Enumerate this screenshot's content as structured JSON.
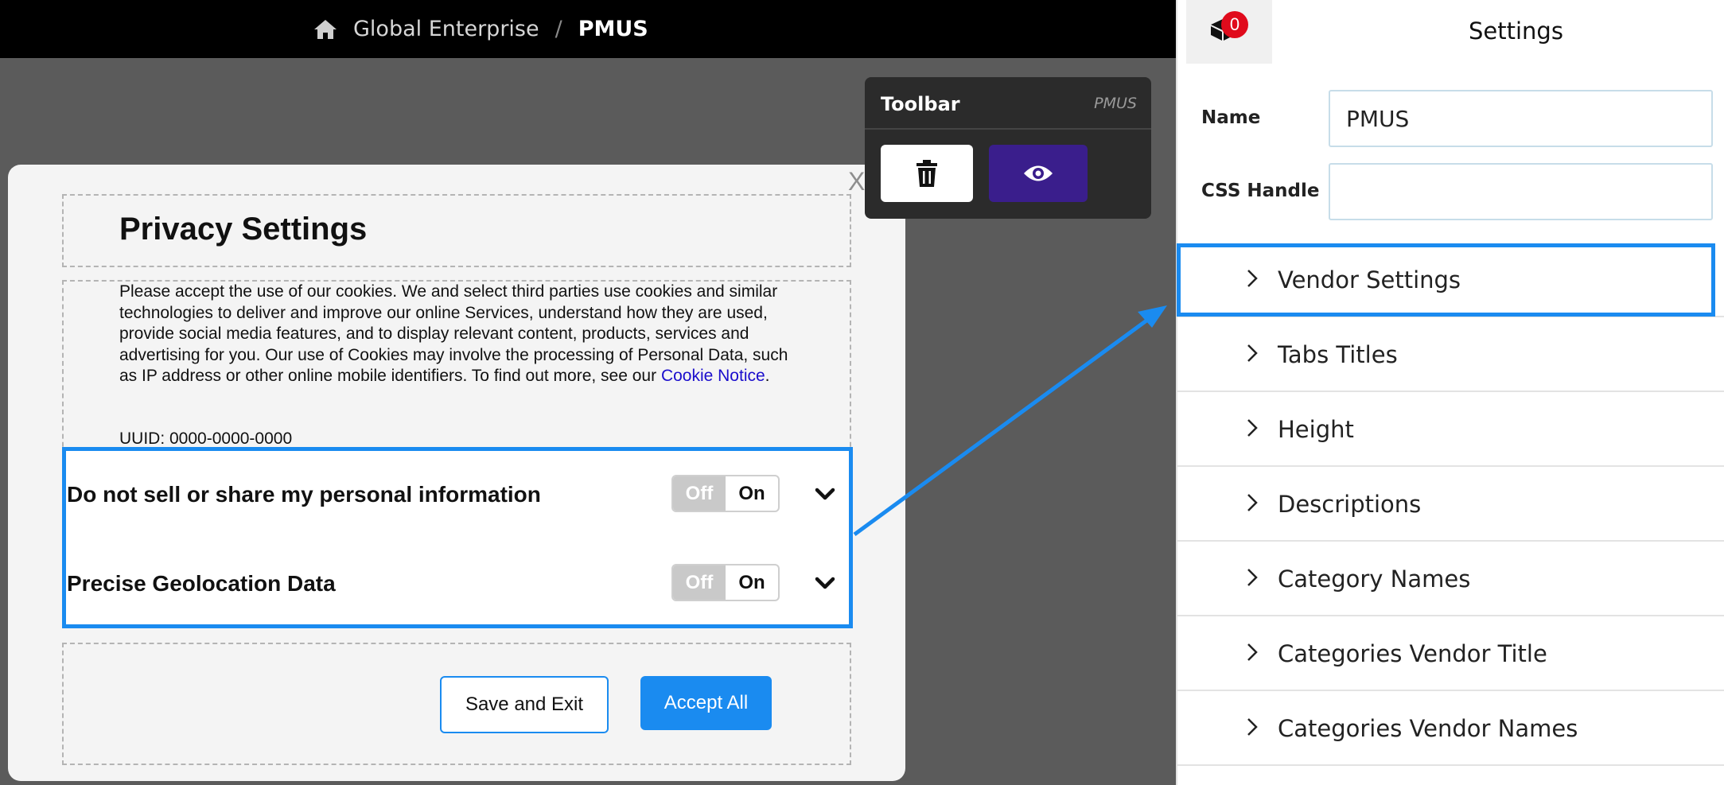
{
  "header": {
    "breadcrumb_root": "Global Enterprise",
    "breadcrumb_separator": "/",
    "breadcrumb_current": "PMUS"
  },
  "modal": {
    "close_label": "X",
    "title": "Privacy Settings",
    "description": "Please accept the use of our cookies. We and select third parties use cookies and similar technologies to deliver and improve our online Services, understand how they are used, provide social media features, and to display relevant content, products, services and advertising for you. Our use of Cookies may involve the processing of Personal Data, such as IP address or other online mobile identifiers. To find out more, see our ",
    "description_link": "Cookie Notice",
    "description_end": ".",
    "uuid": "UUID: 0000-0000-0000",
    "toggles": [
      {
        "label": "Do not sell or share my personal information",
        "off": "Off",
        "on": "On"
      },
      {
        "label": "Precise Geolocation Data",
        "off": "Off",
        "on": "On"
      }
    ],
    "save_label": "Save and Exit",
    "accept_label": "Accept All"
  },
  "toolbar": {
    "title": "Toolbar",
    "subtitle": "PMUS"
  },
  "panel": {
    "badge_count": "0",
    "title": "Settings",
    "name_label": "Name",
    "name_value": "PMUS",
    "css_label": "CSS Handle",
    "css_value": "",
    "sections": [
      "Vendor Settings",
      "Tabs Titles",
      "Height",
      "Descriptions",
      "Category Names",
      "Categories Vendor Title",
      "Categories Vendor Names"
    ]
  },
  "colors": {
    "accent": "#1a8bf0",
    "preview_button": "#3a1e8c",
    "badge": "#e00b1c"
  }
}
